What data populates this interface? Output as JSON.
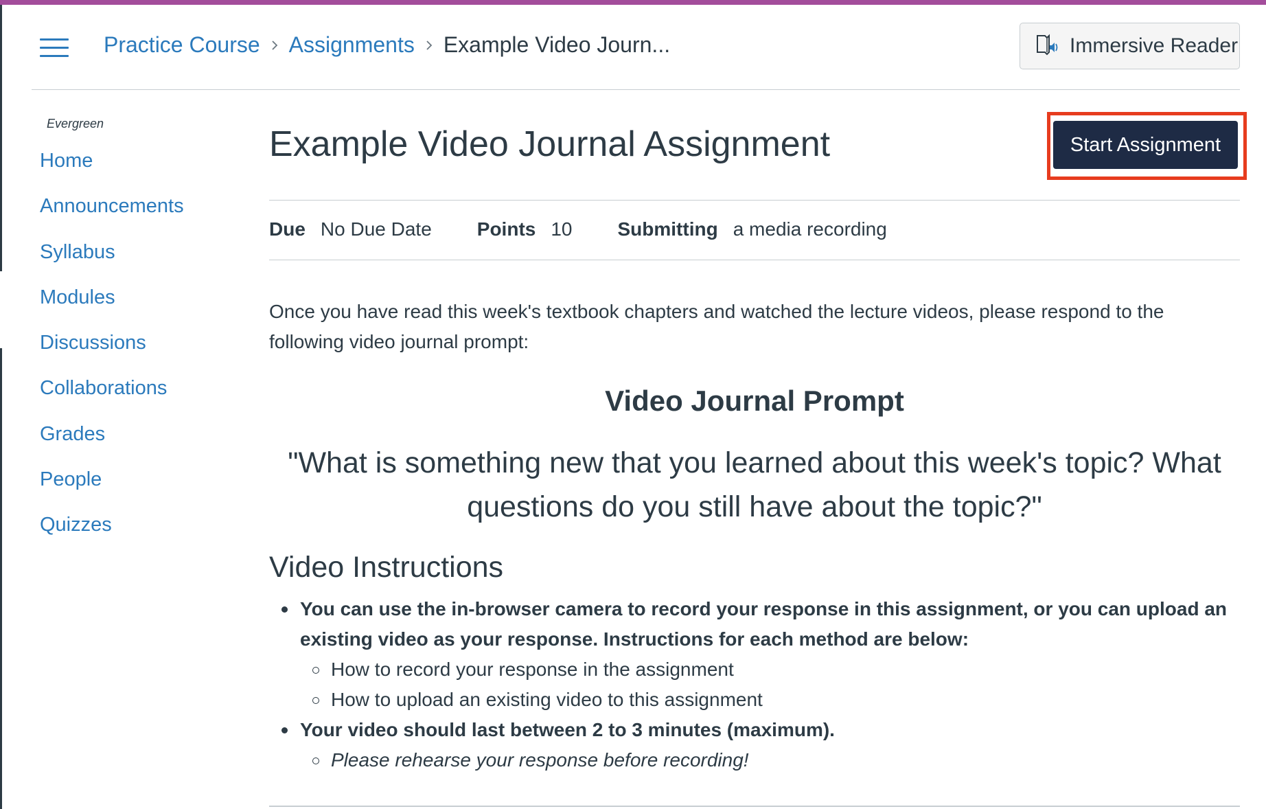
{
  "colors": {
    "accent_top": "#a34d9b",
    "link": "#2b7abc",
    "primary_button": "#1e2b45",
    "highlight_outline": "#e73c1e",
    "text": "#2d3b45"
  },
  "header": {
    "breadcrumb": [
      "Practice Course",
      "Assignments",
      "Example Video Journ..."
    ],
    "breadcrumb_separator": "›",
    "immersive_reader_label": "Immersive Reader",
    "immersive_reader_icon": "book-speaker-icon",
    "menu_icon": "hamburger-icon"
  },
  "sidebar": {
    "term": "Evergreen",
    "items": [
      "Home",
      "Announcements",
      "Syllabus",
      "Modules",
      "Discussions",
      "Collaborations",
      "Grades",
      "People",
      "Quizzes"
    ]
  },
  "assignment": {
    "title": "Example Video Journal Assignment",
    "start_button": "Start Assignment",
    "due_label": "Due",
    "due_value": "No Due Date",
    "points_label": "Points",
    "points_value": "10",
    "submitting_label": "Submitting",
    "submitting_value": "a media recording"
  },
  "content": {
    "intro": "Once you have read this week's textbook chapters and watched the lecture videos, please respond to the following video journal prompt:",
    "prompt_heading": "Video Journal Prompt",
    "prompt_quote": "\"What is something new that you learned about this week's topic? What questions do you still have about the topic?\"",
    "instructions_heading": "Video Instructions",
    "bullet1": "You can use the in-browser camera to record your response in this assignment, or you can upload an existing video as your response. Instructions for each method are below:",
    "bullet1_sub": [
      "How to record your response in the assignment",
      "How to upload an existing video to this assignment"
    ],
    "bullet2": "Your video should last between 2 to 3 minutes (maximum).",
    "bullet2_sub": [
      "Please rehearse your response before recording!"
    ]
  }
}
